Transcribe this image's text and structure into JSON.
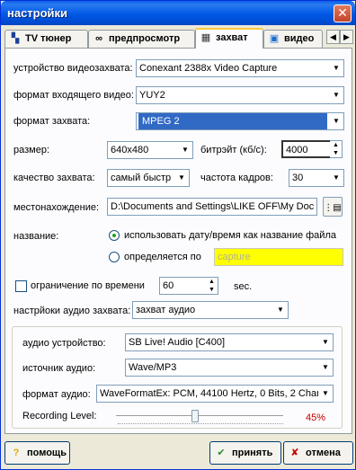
{
  "window": {
    "title": "настройки",
    "close_glyph": "✕"
  },
  "tabs": [
    {
      "label": "TV тюнер",
      "icon": "tv-tuner-icon",
      "glyph": "▚",
      "active": false
    },
    {
      "label": "предпросмотр",
      "icon": "glasses-icon",
      "glyph": "∞",
      "active": false
    },
    {
      "label": "захват",
      "icon": "film-icon",
      "glyph": "▦",
      "active": true
    },
    {
      "label": "видео",
      "icon": "monitor-icon",
      "glyph": "▣",
      "active": false
    }
  ],
  "tab_scroll": {
    "left_glyph": "◀",
    "right_glyph": "▶"
  },
  "capture_device": {
    "label": "устройство видеозахвата:",
    "value": "Conexant 2388x Video Capture"
  },
  "input_format": {
    "label": "формат входящего видео:",
    "value": "YUY2"
  },
  "capture_format": {
    "label": "формат захвата:",
    "value": "MPEG 2"
  },
  "size": {
    "label": "размер:",
    "value": "640x480"
  },
  "bitrate": {
    "label": "битрэйт (кб/с):",
    "value": "4000"
  },
  "quality": {
    "label": "качество захвата:",
    "value": "самый быстр"
  },
  "framerate": {
    "label": "частота кадров:",
    "value": "30"
  },
  "location": {
    "label": "местонахождение:",
    "value": "D:\\Documents and Settings\\LIKE OFF\\My Doc",
    "browse_glyph": "⋮▤"
  },
  "name": {
    "label": "название:",
    "option_auto": "использовать дату/время как название файла",
    "option_custom": "определяется по",
    "custom_value": "capture",
    "selected": "auto"
  },
  "time_limit": {
    "label": "ограничение по времени",
    "value": "60",
    "unit": "sec.",
    "checked": false
  },
  "audio_settings": {
    "label": "настрйоки аудио захвата:",
    "value": "захват аудио"
  },
  "audio": {
    "device_label": "аудио устройство:",
    "device_value": "SB Live! Audio [C400]",
    "source_label": "источник аудио:",
    "source_value": "Wave/MP3",
    "format_label": "формат аудио:",
    "format_value": "WaveFormatEx: PCM, 44100 Hertz, 0 Bits, 2 Chann",
    "level_label": "Recording Level:",
    "level_percent": 45,
    "level_text": "45%"
  },
  "buttons": {
    "help": {
      "label": "помощь",
      "glyph": "?"
    },
    "accept": {
      "label": "принять",
      "glyph": "✔"
    },
    "cancel": {
      "label": "отмена",
      "glyph": "✘"
    }
  },
  "colors": {
    "accent": "#316AC5",
    "title_bar": "#0058E6",
    "highlight_field": "#FFFF00",
    "level_text": "#C00000"
  }
}
